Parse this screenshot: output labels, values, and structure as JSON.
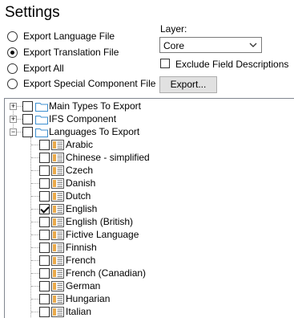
{
  "title": "Settings",
  "export_options": [
    {
      "label": "Export Language File",
      "selected": false
    },
    {
      "label": "Export Translation File",
      "selected": true
    },
    {
      "label": "Export All",
      "selected": false
    },
    {
      "label": "Export Special Component File",
      "selected": false
    }
  ],
  "layer": {
    "label": "Layer:",
    "value": "Core"
  },
  "exclude_field_descriptions": {
    "label": "Exclude Field Descriptions",
    "checked": false
  },
  "export_button": {
    "label": "Export..."
  },
  "tree": {
    "groups": [
      {
        "label": "Main Types To Export",
        "expanded": false,
        "checked": false
      },
      {
        "label": "IFS Component",
        "expanded": false,
        "checked": false
      },
      {
        "label": "Languages To Export",
        "expanded": true,
        "checked": false
      }
    ],
    "languages": [
      {
        "label": "Arabic",
        "checked": false
      },
      {
        "label": "Chinese - simplified",
        "checked": false
      },
      {
        "label": "Czech",
        "checked": false
      },
      {
        "label": "Danish",
        "checked": false
      },
      {
        "label": "Dutch",
        "checked": false
      },
      {
        "label": "English",
        "checked": true
      },
      {
        "label": "English (British)",
        "checked": false
      },
      {
        "label": "Fictive Language",
        "checked": false
      },
      {
        "label": "Finnish",
        "checked": false
      },
      {
        "label": "French",
        "checked": false
      },
      {
        "label": "French (Canadian)",
        "checked": false
      },
      {
        "label": "German",
        "checked": false
      },
      {
        "label": "Hungarian",
        "checked": false
      },
      {
        "label": "Italian",
        "checked": false
      }
    ]
  }
}
